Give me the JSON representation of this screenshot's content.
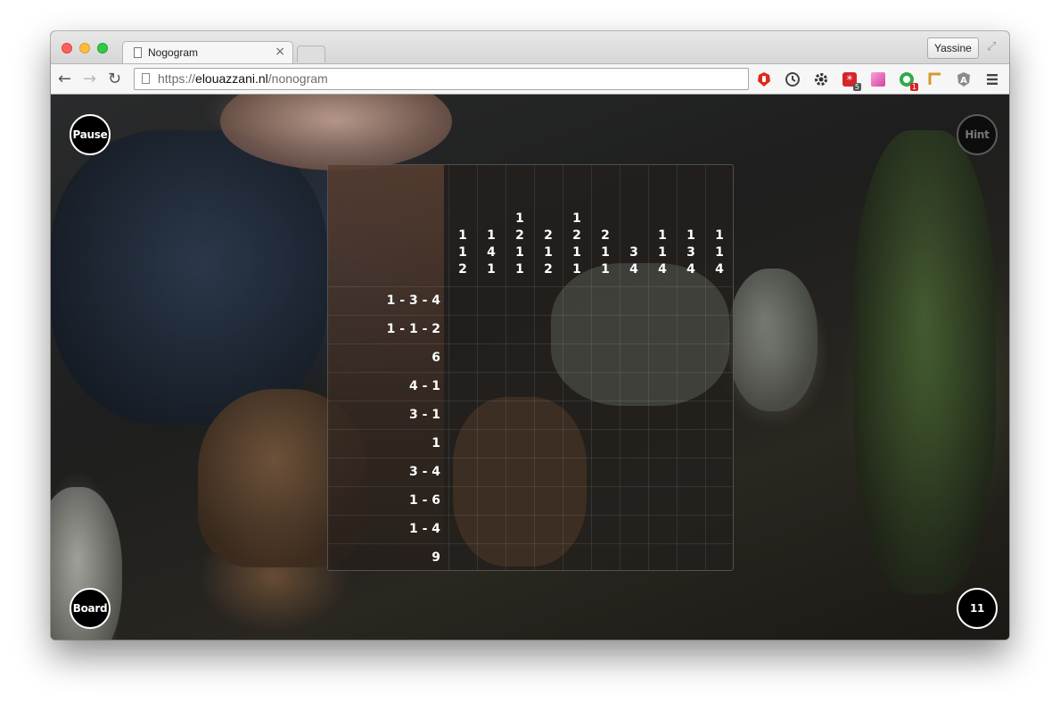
{
  "browser": {
    "tab_title": "Nogogram",
    "tab_close": "×",
    "profile_name": "Yassine",
    "url_scheme": "https://",
    "url_host": "elouazzani.nl",
    "url_path": "/nonogram",
    "extension_badges": {
      "ext4_badge": "5",
      "ext6_badge": "1"
    }
  },
  "game": {
    "pause_label": "Pause",
    "hint_label": "Hint",
    "board_label": "Board",
    "counter": "11",
    "column_clues": [
      [
        "1",
        "1",
        "2"
      ],
      [
        "1",
        "4",
        "1"
      ],
      [
        "1",
        "2",
        "1",
        "1"
      ],
      [
        "2",
        "1",
        "2"
      ],
      [
        "1",
        "2",
        "1",
        "1"
      ],
      [
        "2",
        "1",
        "1"
      ],
      [
        "3",
        "4"
      ],
      [
        "1",
        "1",
        "4"
      ],
      [
        "1",
        "3",
        "4"
      ],
      [
        "1",
        "1",
        "4"
      ]
    ],
    "row_clues": [
      "1 - 3 - 4",
      "1 - 1 - 2",
      "6",
      "4 - 1",
      "3 - 1",
      "1",
      "3 - 4",
      "1 - 6",
      "1 - 4",
      "9"
    ]
  }
}
